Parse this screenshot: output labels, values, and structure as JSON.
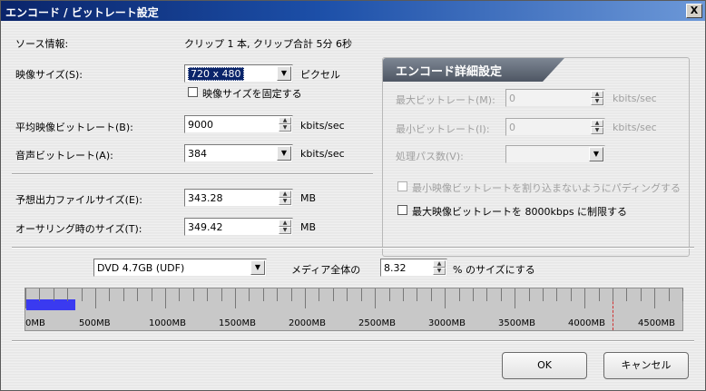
{
  "window": {
    "title": "エンコード / ビットレート設定",
    "close_label": "X"
  },
  "source": {
    "label": "ソース情報:",
    "value": "クリップ 1 本, クリップ合計 5分 6秒"
  },
  "video_size": {
    "label": "映像サイズ(S):",
    "value": "720 x 480",
    "unit": "ピクセル",
    "fix_label": "映像サイズを固定する",
    "fix_checked": false
  },
  "avg_bitrate": {
    "label": "平均映像ビットレート(B):",
    "value": "9000",
    "unit": "kbits/sec"
  },
  "audio_bitrate": {
    "label": "音声ビットレート(A):",
    "value": "384",
    "unit": "kbits/sec"
  },
  "predicted_size": {
    "label": "予想出力ファイルサイズ(E):",
    "value": "343.28",
    "unit": "MB"
  },
  "authoring_size": {
    "label": "オーサリング時のサイズ(T):",
    "value": "349.42",
    "unit": "MB"
  },
  "advanced": {
    "title": "エンコード詳細設定",
    "max_bitrate": {
      "label": "最大ビットレート(M):",
      "value": "0",
      "unit": "kbits/sec"
    },
    "min_bitrate": {
      "label": "最小ビットレート(I):",
      "value": "0",
      "unit": "kbits/sec"
    },
    "passes": {
      "label": "処理パス数(V):",
      "value": ""
    },
    "padding": {
      "label": "最小映像ビットレートを割り込まないようにパディングする",
      "checked": false
    },
    "limit": {
      "label": "最大映像ビットレートを 8000kbps に制限する",
      "checked": false
    }
  },
  "media": {
    "value": "DVD 4.7GB (UDF)",
    "percent_label": "メディア全体の",
    "percent": "8.32",
    "percent_suffix": "% のサイズにする"
  },
  "capacity_bar": {
    "ticks": [
      "0MB",
      "500MB",
      "1000MB",
      "1500MB",
      "2000MB",
      "2500MB",
      "3000MB",
      "3500MB",
      "4000MB",
      "4500MB"
    ],
    "used_mb": 349.42,
    "max_mb": 4700,
    "limit_mb": 4200,
    "fill_color": "#3a3af0",
    "limit_color": "#d03030"
  },
  "buttons": {
    "ok": "OK",
    "cancel": "キャンセル"
  }
}
